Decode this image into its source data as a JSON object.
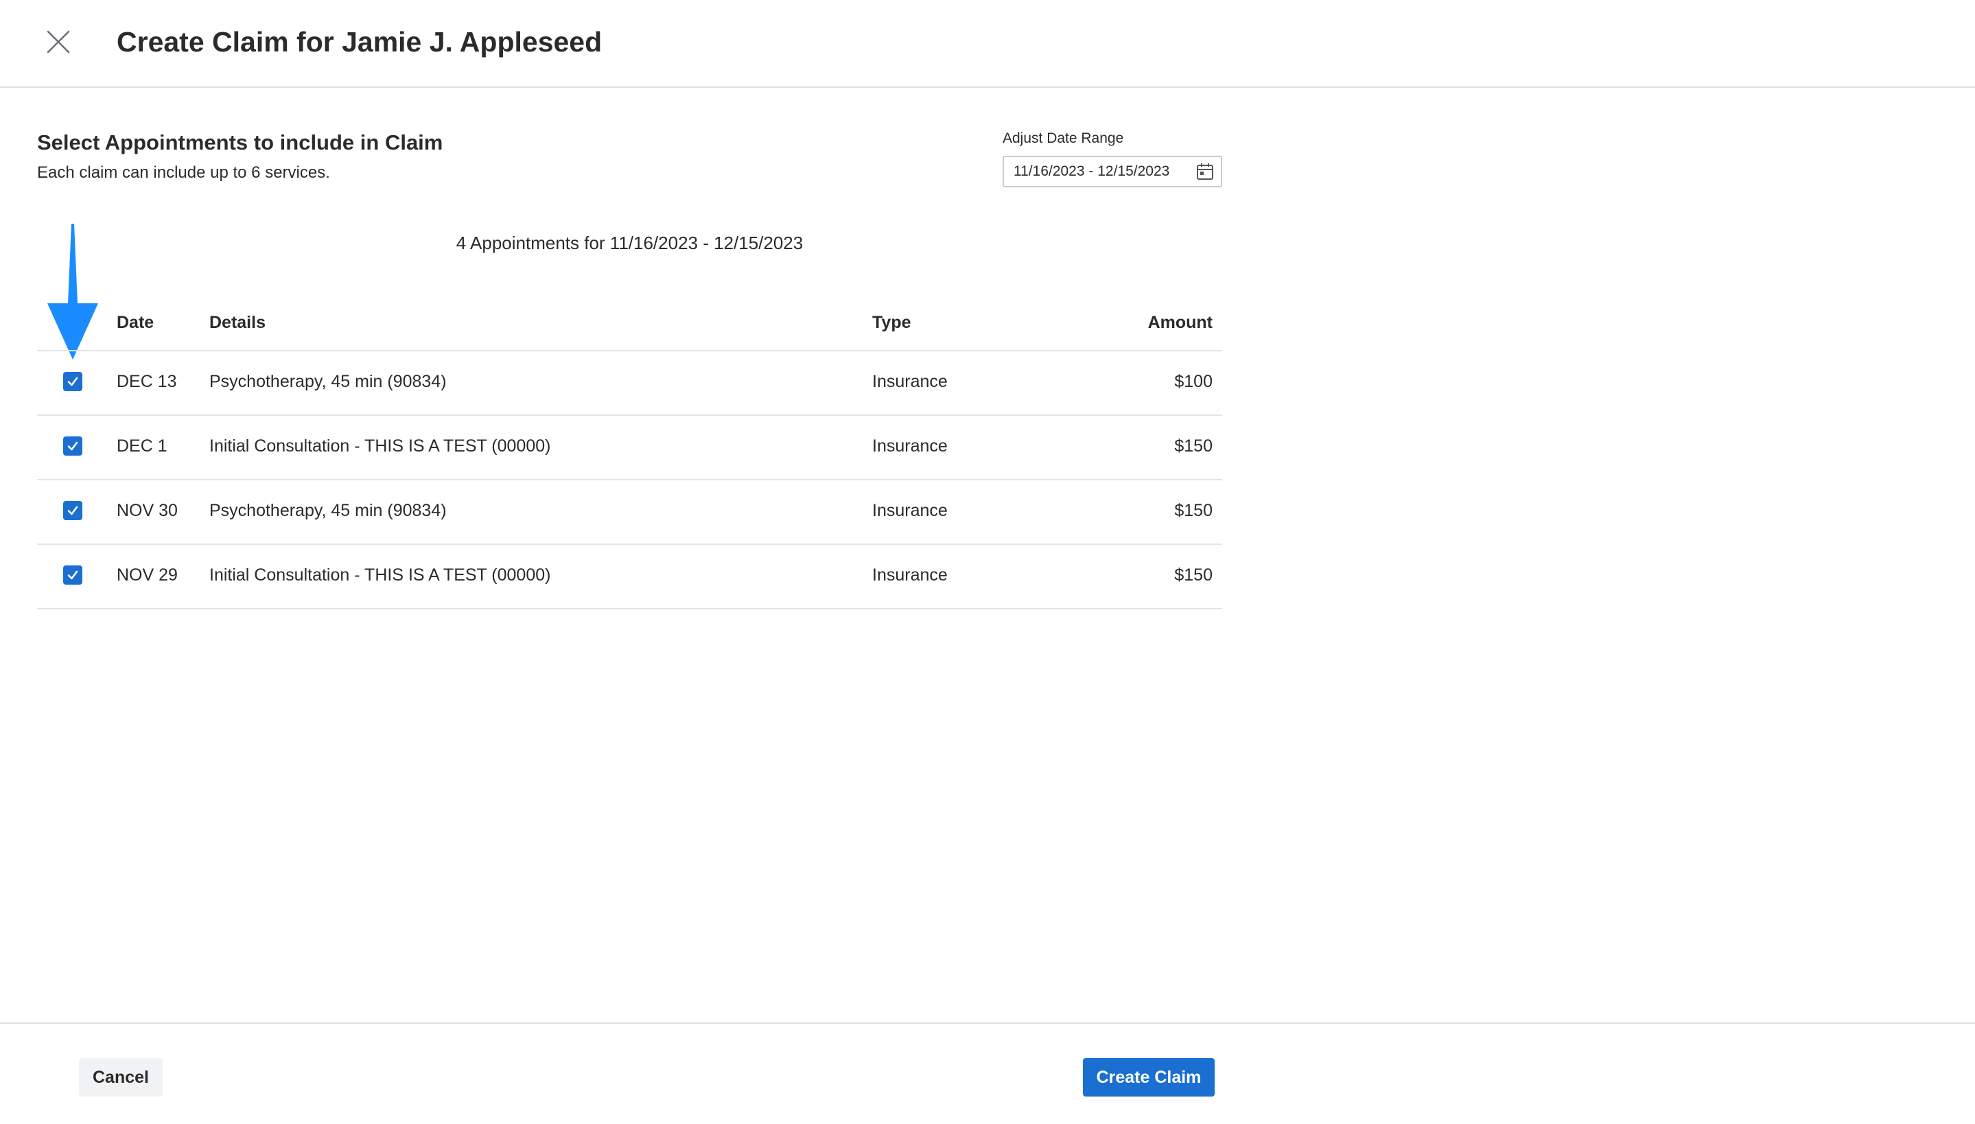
{
  "header": {
    "title": "Create Claim for Jamie J. Appleseed",
    "close_icon": "close-icon"
  },
  "section": {
    "title": "Select Appointments to include in Claim",
    "subtitle": "Each claim can include up to 6 services."
  },
  "date_range": {
    "label": "Adjust Date Range",
    "value": "11/16/2023 - 12/15/2023",
    "icon": "calendar-icon"
  },
  "appointments_summary": "4 Appointments for 11/16/2023 - 12/15/2023",
  "annotation": {
    "icon": "arrow-down-icon",
    "color": "#1a8cff"
  },
  "table": {
    "columns": {
      "date": "Date",
      "details": "Details",
      "type": "Type",
      "amount": "Amount"
    },
    "rows": [
      {
        "checked": true,
        "date": "DEC 13",
        "details": "Psychotherapy, 45 min (90834)",
        "type": "Insurance",
        "amount": "$100"
      },
      {
        "checked": true,
        "date": "DEC 1",
        "details": "Initial Consultation - THIS IS A TEST (00000)",
        "type": "Insurance",
        "amount": "$150"
      },
      {
        "checked": true,
        "date": "NOV 30",
        "details": "Psychotherapy, 45 min (90834)",
        "type": "Insurance",
        "amount": "$150"
      },
      {
        "checked": true,
        "date": "NOV 29",
        "details": "Initial Consultation - THIS IS A TEST (00000)",
        "type": "Insurance",
        "amount": "$150"
      }
    ]
  },
  "footer": {
    "cancel_label": "Cancel",
    "create_label": "Create Claim"
  },
  "colors": {
    "primary": "#1a6fd1",
    "divider": "#dcdfe6"
  }
}
